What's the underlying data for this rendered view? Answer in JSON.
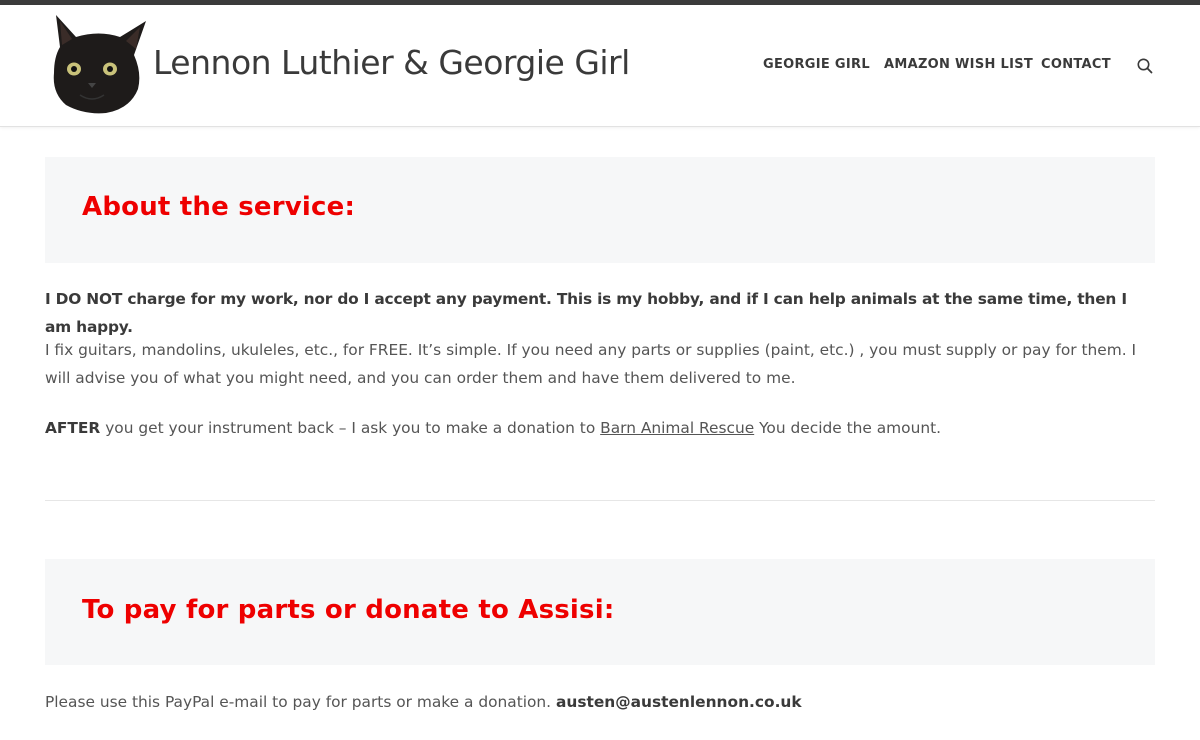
{
  "header": {
    "site_title": "Lennon Luthier & Georgie Girl",
    "nav": [
      {
        "label": "GEORGIE GIRL"
      },
      {
        "label": "AMAZON WISH LIST"
      },
      {
        "label": "CONTACT"
      }
    ]
  },
  "section1": {
    "heading": "About the service:",
    "p1": "I DO NOT charge for my work, nor do I accept any payment. This is my hobby, and if I can help animals at the same time, then I am happy.",
    "p2": "I fix guitars, mandolins, ukuleles, etc., for FREE. It’s simple. If you need any parts or supplies (paint, etc.)  , you must supply or pay for them. I will advise you of what you might need, and you can order them and have them delivered to me.",
    "p3_strong": "AFTER",
    "p3_before_link": " you get your instrument back – I ask you to make a donation to ",
    "p3_link": "Barn Animal Rescue",
    "p3_after_link": " You decide the amount."
  },
  "section2": {
    "heading": "To pay for parts or donate to Assisi:",
    "p1_text": "Please use this PayPal e-mail to pay for parts or make a donation. ",
    "p1_email": "austen@austenlennon.co.uk"
  },
  "colors": {
    "heading_red": "#ee0000",
    "text": "#555555",
    "panel_bg": "#f6f7f8",
    "topbar": "#3b3b3b"
  },
  "icons": {
    "logo": "black-cat-logo-icon",
    "search": "search-icon"
  }
}
